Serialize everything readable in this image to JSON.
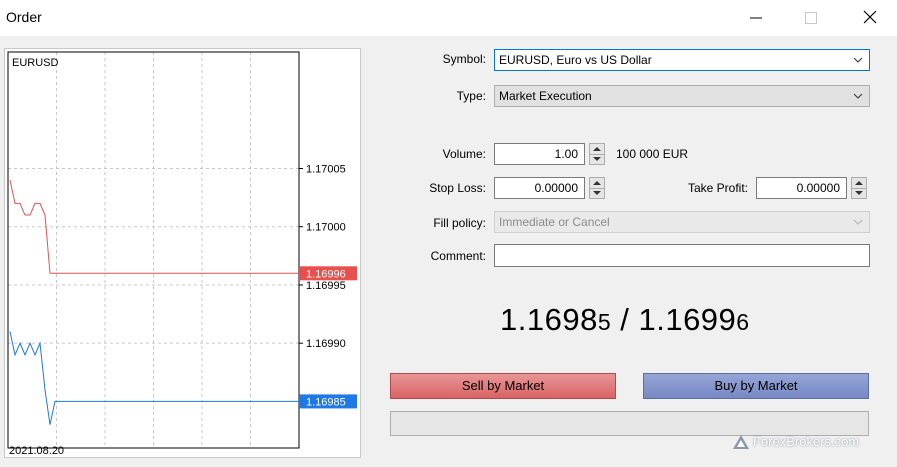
{
  "window": {
    "title": "Order",
    "minimize_icon": "minimize-icon",
    "maximize_icon": "maximize-icon",
    "close_icon": "close-icon"
  },
  "chart": {
    "symbol": "EURUSD",
    "date": "2021.08.20",
    "y_ticks": [
      "1.17005",
      "1.17000",
      "1.16995",
      "1.16990"
    ],
    "ask_label": "1.16996",
    "bid_label": "1.16985",
    "ask_color": "#e8504e",
    "bid_color": "#1e78e6"
  },
  "chart_data": {
    "type": "line",
    "title": "EURUSD",
    "xlabel": "",
    "ylabel": "",
    "x_tick_labels": [
      "2021.08.20"
    ],
    "y_tick_labels": [
      "1.17005",
      "1.17000",
      "1.16995",
      "1.16990"
    ],
    "ylim": [
      1.16981,
      1.17015
    ],
    "grid": true,
    "series": [
      {
        "values": [
          1.17004,
          1.17002,
          1.17002,
          1.17001,
          1.17001,
          1.17002,
          1.17002,
          1.17001,
          1.16996,
          1.16996,
          1.16996,
          1.16996,
          1.16996,
          1.16996
        ],
        "color": "#e8504e"
      },
      {
        "values": [
          1.16991,
          1.16989,
          1.1699,
          1.16989,
          1.1699,
          1.16989,
          1.1699,
          1.16986,
          1.16983,
          1.16985,
          1.16985,
          1.16985,
          1.16985,
          1.16985
        ],
        "color": "#1e78e6"
      }
    ],
    "current_labels": {
      "ask": 1.16996,
      "bid": 1.16985
    }
  },
  "form": {
    "symbol_label": "Symbol:",
    "symbol_value": "EURUSD, Euro vs US Dollar",
    "type_label": "Type:",
    "type_value": "Market Execution",
    "volume_label": "Volume:",
    "volume_value": "1.00",
    "volume_units": "100 000 EUR",
    "stop_loss_label": "Stop Loss:",
    "stop_loss_value": "0.00000",
    "take_profit_label": "Take Profit:",
    "take_profit_value": "0.00000",
    "fill_policy_label": "Fill policy:",
    "fill_policy_value": "Immediate or Cancel",
    "comment_label": "Comment:",
    "comment_value": ""
  },
  "quote": {
    "bid_main": "1.1698",
    "bid_small": "5",
    "separator": " / ",
    "ask_main": "1.1699",
    "ask_small": "6"
  },
  "buttons": {
    "sell": "Sell by Market",
    "buy": "Buy by Market"
  },
  "watermark": {
    "text": "ForexBrokers.com"
  }
}
